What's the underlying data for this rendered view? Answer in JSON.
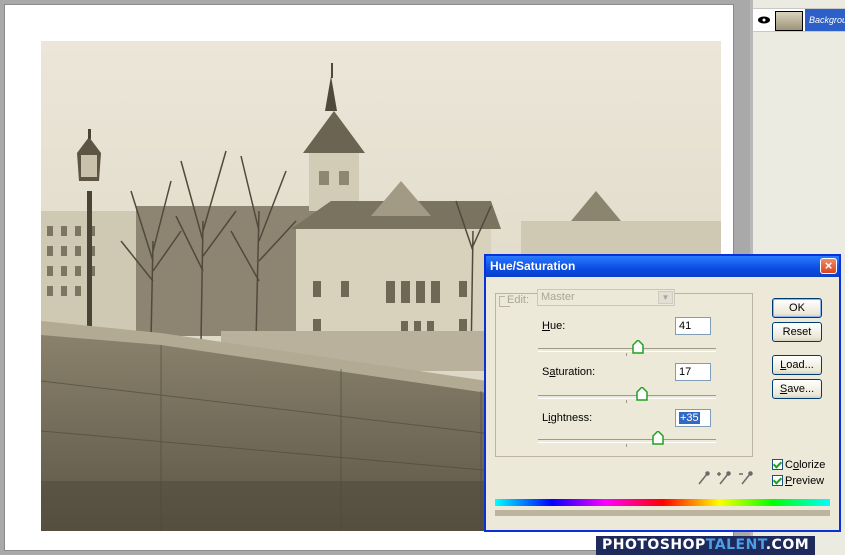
{
  "layers": {
    "layer_name": "Background"
  },
  "dialog": {
    "title": "Hue/Saturation",
    "close_glyph": "×",
    "edit_label": "Edit:",
    "edit_value": "Master",
    "hue": {
      "label_underlined": "H",
      "label_rest": "ue:",
      "value": "41",
      "slider_fraction": 0.56
    },
    "saturation": {
      "label_pre": "S",
      "label_underlined": "a",
      "label_rest": "turation:",
      "value": "17",
      "slider_fraction": 0.585
    },
    "lightness": {
      "label_pre": "L",
      "label_underlined": "i",
      "label_rest": "ghtness:",
      "value": "+35",
      "slider_fraction": 0.675
    },
    "buttons": {
      "ok": "OK",
      "reset": "Reset",
      "load_u": "L",
      "load_rest": "oad...",
      "save_u": "S",
      "save_rest": "ave..."
    },
    "colorize_pre": "C",
    "colorize_u": "o",
    "colorize_rest": "lorize",
    "preview_u": "P",
    "preview_rest": "review",
    "colorize_checked": true,
    "preview_checked": true
  },
  "watermark": {
    "part1": "PHOTOSHOP",
    "part2": "TALENT",
    "part3": ".COM"
  },
  "colors": {
    "title_blue": "#0a4ce0",
    "sepia": "#bdb49d"
  }
}
